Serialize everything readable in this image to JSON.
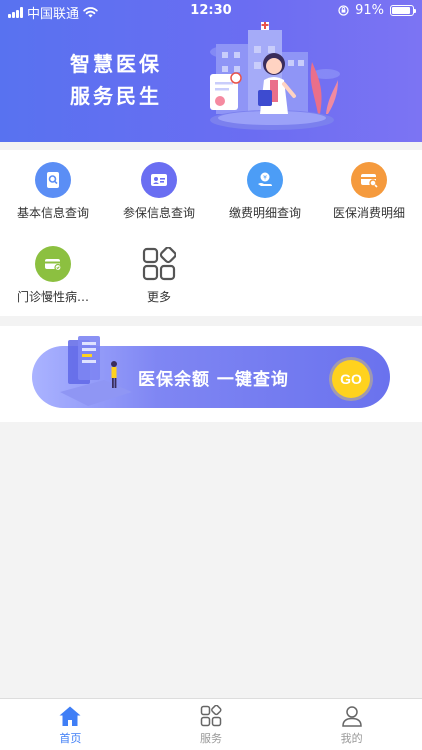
{
  "status_bar": {
    "carrier": "中国联通",
    "time": "12:30",
    "battery_text": "91%",
    "battery_level": 0.91
  },
  "banner": {
    "line1": "智慧医保",
    "line2": "服务民生"
  },
  "functions": [
    {
      "label": "基本信息查询",
      "icon": "id-search-icon",
      "color": "#5b8ef5"
    },
    {
      "label": "参保信息查询",
      "icon": "id-card-icon",
      "color": "#6a6ef2"
    },
    {
      "label": "缴费明细查询",
      "icon": "payment-hand-icon",
      "color": "#4c9df6"
    },
    {
      "label": "医保消费明细",
      "icon": "card-search-icon",
      "color": "#f59a3d"
    },
    {
      "label": "门诊慢性病…",
      "icon": "card-check-icon",
      "color": "#8cc040"
    },
    {
      "label": "更多",
      "icon": "more-grid-icon",
      "color": "#555555"
    }
  ],
  "promo": {
    "text": "医保余额 一键查询",
    "go": "GO"
  },
  "tabbar": [
    {
      "label": "首页",
      "icon": "home-icon",
      "active": true
    },
    {
      "label": "服务",
      "icon": "services-grid-icon",
      "active": false
    },
    {
      "label": "我的",
      "icon": "user-icon",
      "active": false
    }
  ],
  "colors": {
    "header_start": "#5872f0",
    "header_end": "#7c74f3",
    "active_tab": "#3f7ef6",
    "go_button": "#ffd21e"
  }
}
